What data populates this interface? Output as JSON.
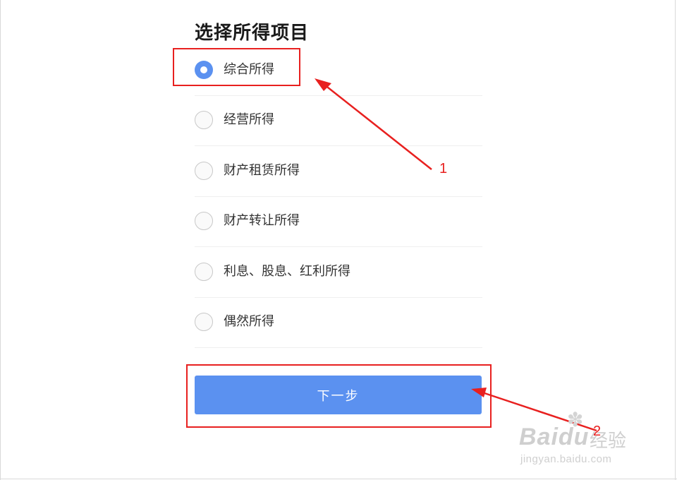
{
  "page": {
    "title": "选择所得项目",
    "options": [
      {
        "label": "综合所得",
        "checked": true
      },
      {
        "label": "经营所得",
        "checked": false
      },
      {
        "label": "财产租赁所得",
        "checked": false
      },
      {
        "label": "财产转让所得",
        "checked": false
      },
      {
        "label": "利息、股息、红利所得",
        "checked": false
      },
      {
        "label": "偶然所得",
        "checked": false
      }
    ],
    "next_button_label": "下一步"
  },
  "annotations": {
    "callout_1": "1",
    "callout_2": "2",
    "color": "#e8201f"
  },
  "watermark": {
    "brand": "Baidu",
    "product": "经验",
    "url": "jingyan.baidu.com"
  },
  "colors": {
    "accent": "#5b91f0"
  }
}
